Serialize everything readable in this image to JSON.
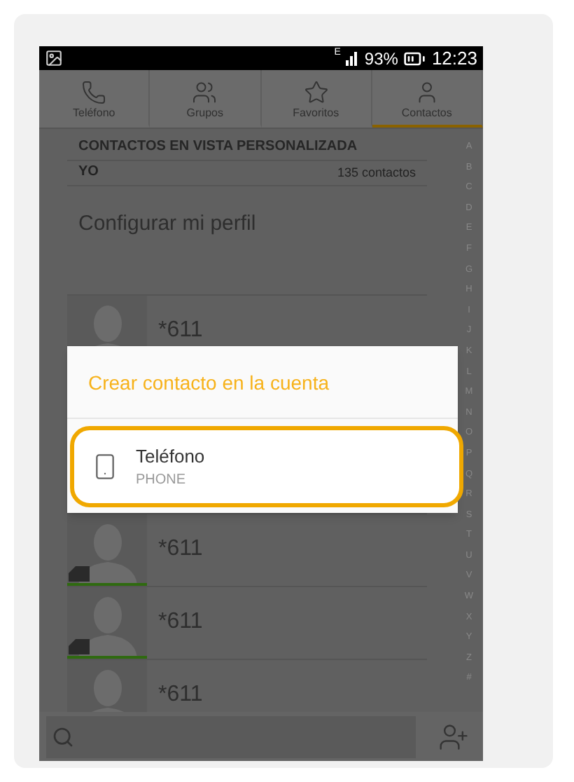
{
  "status_bar": {
    "signal_label": "E",
    "battery": "93%",
    "time": "12:23"
  },
  "tabs": [
    {
      "label": "Teléfono",
      "kind": "phone",
      "selected": false
    },
    {
      "label": "Grupos",
      "kind": "groups",
      "selected": false
    },
    {
      "label": "Favoritos",
      "kind": "star",
      "selected": false
    },
    {
      "label": "Contactos",
      "kind": "person",
      "selected": true
    }
  ],
  "section_header": "CONTACTOS EN VISTA PERSONALIZADA",
  "me": {
    "label": "YO",
    "count": "135 contactos"
  },
  "profile_link": "Configurar mi perfil",
  "contacts": [
    {
      "name": "*611"
    },
    {
      "name": "*611"
    },
    {
      "name": "*611"
    },
    {
      "name": "*611"
    }
  ],
  "index_letters": [
    "A",
    "B",
    "C",
    "D",
    "E",
    "F",
    "G",
    "H",
    "I",
    "J",
    "K",
    "L",
    "M",
    "N",
    "O",
    "P",
    "Q",
    "R",
    "S",
    "T",
    "U",
    "V",
    "W",
    "X",
    "Y",
    "Z",
    "#"
  ],
  "dialog": {
    "title": "Crear contacto en la cuenta",
    "accounts": [
      {
        "name": "Teléfono",
        "type": "PHONE",
        "highlighted": true
      }
    ]
  }
}
